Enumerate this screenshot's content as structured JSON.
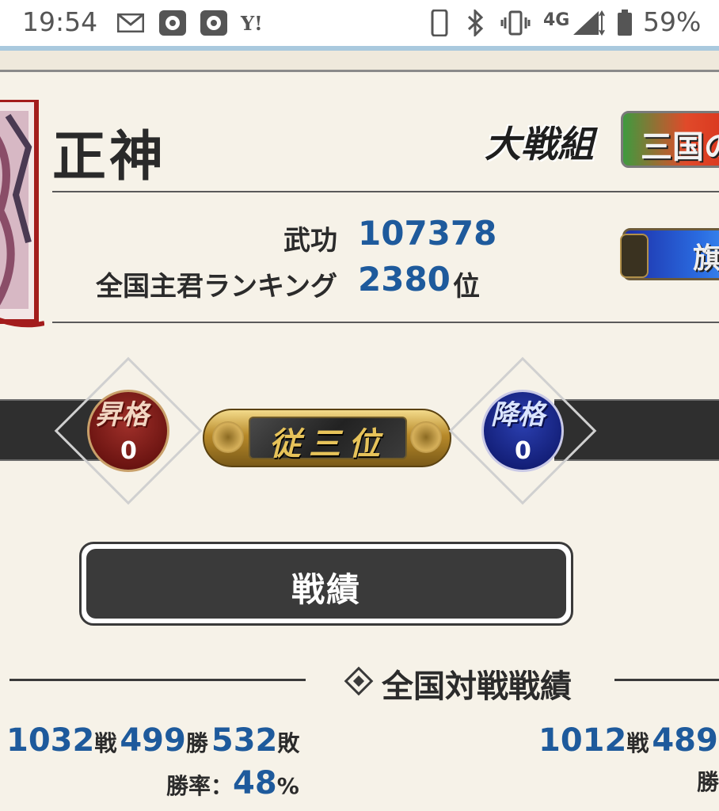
{
  "status_bar": {
    "time": "19:54",
    "network": "4G",
    "battery": "59%",
    "yahoo_label": "Y!",
    "icons": [
      "mail-icon",
      "app-icon",
      "app-icon",
      "yahoo-icon",
      "phone-icon",
      "bluetooth-icon",
      "vibrate-icon",
      "signal-icon",
      "battery-icon"
    ]
  },
  "profile": {
    "name": "正神",
    "group_label": "大戦組",
    "group_button_label": "三国の",
    "flag_button_label": "旗",
    "stats": [
      {
        "label": "武功",
        "value": "107378",
        "unit": ""
      },
      {
        "label": "全国主君ランキング",
        "value": "2380",
        "unit": "位"
      }
    ]
  },
  "rank": {
    "promotion": {
      "label": "昇格",
      "count": "0"
    },
    "current": "従三位",
    "demotion": {
      "label": "降格",
      "count": "0"
    }
  },
  "record_button": {
    "label": "戦績"
  },
  "section": {
    "title": "全国対戦戦績"
  },
  "records": {
    "left": {
      "battles": "1032",
      "battles_unit": "戦",
      "wins": "499",
      "wins_unit": "勝",
      "losses": "532",
      "losses_unit": "敗",
      "rate_label": "勝率：",
      "rate": "48",
      "rate_unit": "%"
    },
    "right": {
      "battles": "1012",
      "battles_unit": "戦",
      "wins": "489",
      "rate_label": "勝"
    }
  },
  "colors": {
    "accent_blue": "#1e5a9c",
    "background": "#f6f2e8",
    "dark_panel": "#3a3a3a"
  }
}
